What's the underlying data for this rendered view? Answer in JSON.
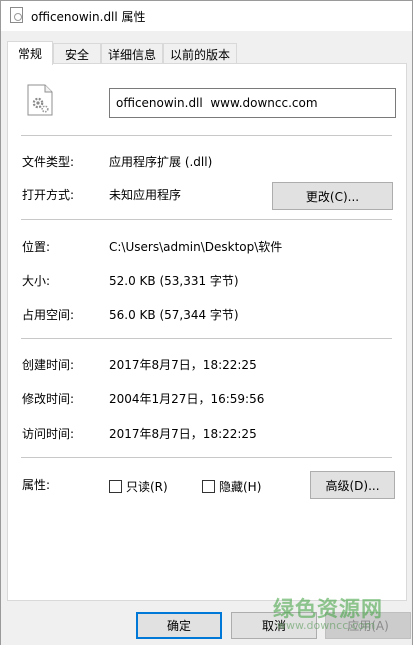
{
  "window": {
    "title": "officenowin.dll 属性"
  },
  "tabs": [
    {
      "label": "常规",
      "active": true
    },
    {
      "label": "安全",
      "active": false
    },
    {
      "label": "详细信息",
      "active": false
    },
    {
      "label": "以前的版本",
      "active": false
    }
  ],
  "general": {
    "file_name": "officenowin.dll  www.downcc.com",
    "file_type_label": "文件类型:",
    "file_type_value": "应用程序扩展 (.dll)",
    "opens_with_label": "打开方式:",
    "opens_with_value": "未知应用程序",
    "change_button": "更改(C)...",
    "location_label": "位置:",
    "location_value": "C:\\Users\\admin\\Desktop\\软件",
    "size_label": "大小:",
    "size_value": "52.0 KB (53,331 字节)",
    "size_on_disk_label": "占用空间:",
    "size_on_disk_value": "56.0 KB (57,344 字节)",
    "created_label": "创建时间:",
    "created_value": "2017年8月7日，18:22:25",
    "modified_label": "修改时间:",
    "modified_value": "2004年1月27日，16:59:56",
    "accessed_label": "访问时间:",
    "accessed_value": "2017年8月7日，18:22:25",
    "attributes_label": "属性:",
    "readonly_label": "只读(R)",
    "hidden_label": "隐藏(H)",
    "advanced_button": "高级(D)..."
  },
  "footer": {
    "ok_button": "确定",
    "cancel_button": "取消",
    "apply_button": "应用(A)"
  },
  "watermark": {
    "text": "绿色资源网",
    "url": "www.downcc.com"
  },
  "icons": {
    "title": "dll-file-icon",
    "file": "dll-file-gear-icon"
  },
  "colors": {
    "default_button_border": "#0078d7",
    "watermark": "#3ca03c"
  }
}
